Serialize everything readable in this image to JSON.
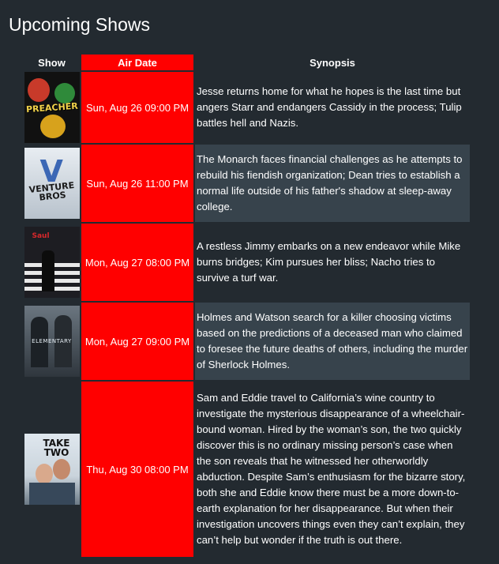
{
  "page": {
    "title": "Upcoming Shows"
  },
  "table": {
    "headers": {
      "show": "Show",
      "air_date": "Air Date",
      "synopsis": "Synopsis"
    },
    "rows": [
      {
        "poster_icon": "preacher-poster",
        "poster_label": "PREACHER",
        "air_date": "Sun, Aug 26 09:00 PM",
        "synopsis": "Jesse returns home for what he hopes is the last time but angers Starr and endangers Cassidy in the process; Tulip battles hell and Nazis."
      },
      {
        "poster_icon": "venture-bros-poster",
        "poster_label": "VENTURE BROS",
        "air_date": "Sun, Aug 26 11:00 PM",
        "synopsis": "The Monarch faces financial challenges as he attempts to rebuild his fiendish organization; Dean tries to establish a normal life outside of his father's shadow at sleep-away college."
      },
      {
        "poster_icon": "better-call-saul-poster",
        "poster_label": "Saul",
        "air_date": "Mon, Aug 27 08:00 PM",
        "synopsis": "A restless Jimmy embarks on a new endeavor while Mike burns bridges; Kim pursues her bliss; Nacho tries to survive a turf war."
      },
      {
        "poster_icon": "elementary-poster",
        "poster_label": "ELEMENTARY",
        "air_date": "Mon, Aug 27 09:00 PM",
        "synopsis": "Holmes and Watson search for a killer choosing victims based on the predictions of a deceased man who claimed to foresee the future deaths of others, including the murder of Sherlock Holmes."
      },
      {
        "poster_icon": "take-two-poster",
        "poster_label": "TAKE TWO",
        "air_date": "Thu, Aug 30 08:00 PM",
        "synopsis": "Sam and Eddie travel to California’s wine country to investigate the mysterious disappearance of a wheelchair-bound woman. Hired by the woman’s son, the two quickly discover this is no ordinary missing person’s case when the son reveals that he witnessed her otherworldly abduction. Despite Sam’s enthusiasm for the bizarre story, both she and Eddie know there must be a more down-to-earth explanation for her disappearance. But when their investigation uncovers things even they can’t explain, they can’t help but wonder if the truth is out there."
      }
    ]
  },
  "colors": {
    "background": "#232a30",
    "header_accent": "#ff0000",
    "alt_row": "#37434c",
    "text": "#ffffff"
  }
}
